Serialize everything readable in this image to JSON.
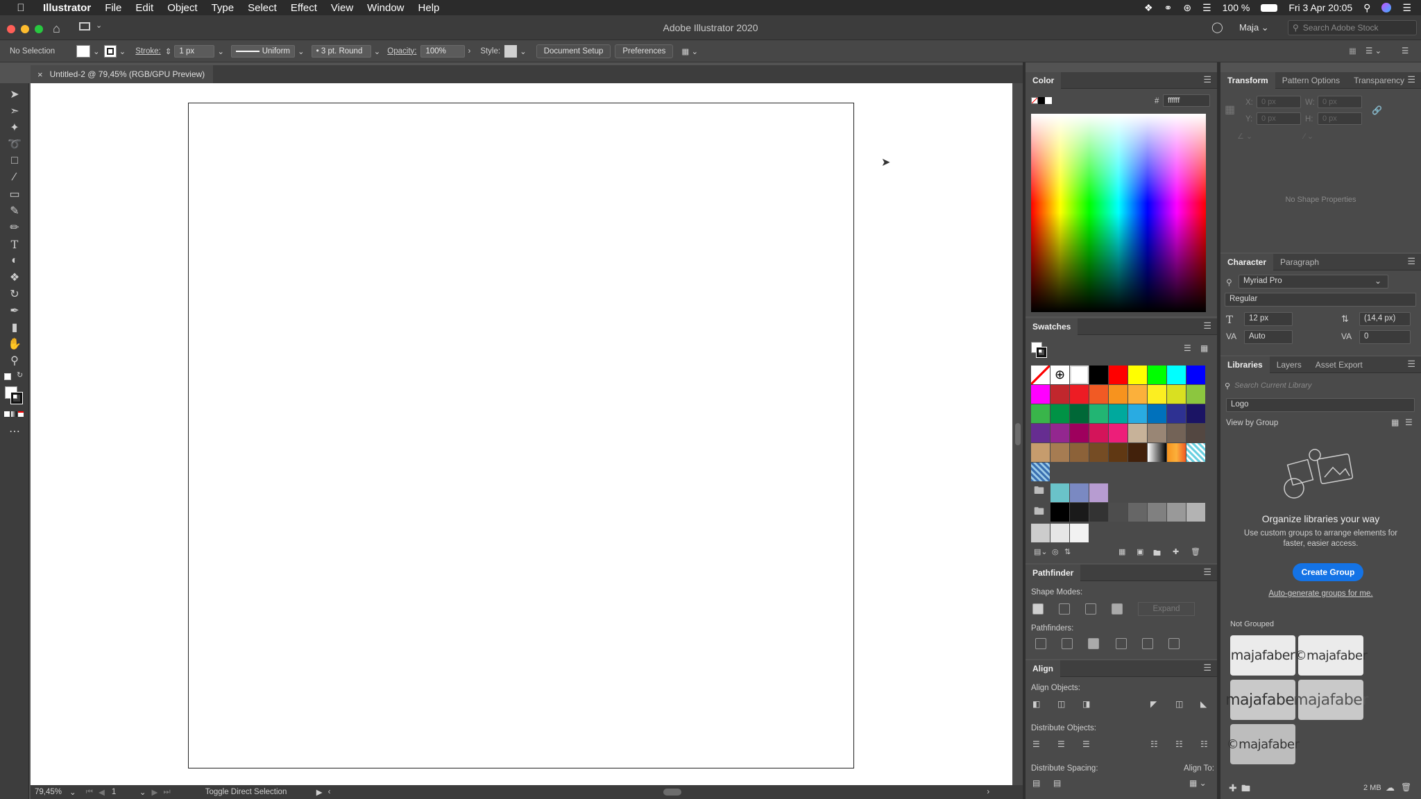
{
  "menubar": {
    "app": "Illustrator",
    "items": [
      "File",
      "Edit",
      "Object",
      "Type",
      "Select",
      "Effect",
      "View",
      "Window",
      "Help"
    ],
    "battery": "100 %",
    "clock": "Fri 3 Apr  20:05"
  },
  "titlebar": {
    "title": "Adobe Illustrator 2020",
    "user": "Maja",
    "search_placeholder": "Search Adobe Stock"
  },
  "controlbar": {
    "selection": "No Selection",
    "stroke_label": "Stroke:",
    "stroke_value": "1 px",
    "profile": "Uniform",
    "brush": "3 pt. Round",
    "opacity_label": "Opacity:",
    "opacity_value": "100%",
    "style_label": "Style:",
    "doc_setup": "Document Setup",
    "preferences": "Preferences"
  },
  "document": {
    "tab_title": "Untitled-2 @ 79,45% (RGB/GPU Preview)"
  },
  "statusbar": {
    "zoom": "79,45%",
    "artboard": "1",
    "hint": "Toggle Direct Selection"
  },
  "color_panel": {
    "title": "Color",
    "hex_label": "#",
    "hex": "ffffff"
  },
  "swatches_panel": {
    "title": "Swatches",
    "colors": [
      "#000000",
      "#ff0000",
      "#ffff00",
      "#00ff00",
      "#00ffff",
      "#0000ff",
      "#ff00ff",
      "#c1272d",
      "#ed1c24",
      "#f15a24",
      "#f7931e",
      "#fbb03b",
      "#fcee21",
      "#d9e021",
      "#8cc63f",
      "#39b54a",
      "#009245",
      "#006837",
      "#22b573",
      "#00a99d",
      "#29abe2",
      "#0071bc",
      "#2e3192",
      "#1b1464",
      "#662d91",
      "#93278f",
      "#9e005d",
      "#d4145a",
      "#ed1e79",
      "#c7b299",
      "#998675",
      "#736357",
      "#534741",
      "#c69c6d",
      "#a67c52",
      "#8c6239",
      "#754c24",
      "#603813",
      "#42210b"
    ],
    "group1": [
      "#6ac3c9",
      "#7a89c2",
      "#b79cd1"
    ],
    "group2": [
      "#000000",
      "#1a1a1a",
      "#333333",
      "#4d4d4d",
      "#666666",
      "#808080",
      "#999999",
      "#b3b3b3",
      "#cccccc",
      "#e6e6e6",
      "#f2f2f2"
    ]
  },
  "pathfinder_panel": {
    "title": "Pathfinder",
    "shape_modes": "Shape Modes:",
    "expand": "Expand",
    "pathfinders": "Pathfinders:"
  },
  "align_panel": {
    "title": "Align",
    "align_objects": "Align Objects:",
    "distribute_objects": "Distribute Objects:",
    "distribute_spacing": "Distribute Spacing:",
    "align_to": "Align To:"
  },
  "transform_panel": {
    "tabs": [
      "Transform",
      "Pattern Options",
      "Transparency"
    ],
    "x": "X:",
    "y": "Y:",
    "w": "W:",
    "h": "H:",
    "x_val": "0 px",
    "y_val": "0 px",
    "w_val": "0 px",
    "h_val": "0 px",
    "empty": "No Shape Properties"
  },
  "character_panel": {
    "tabs": [
      "Character",
      "Paragraph"
    ],
    "font": "Myriad Pro",
    "style": "Regular",
    "size": "12 px",
    "leading": "(14,4 px)",
    "kerning": "Auto",
    "tracking": "0"
  },
  "libraries_panel": {
    "tabs": [
      "Libraries",
      "Layers",
      "Asset Export"
    ],
    "search_placeholder": "Search Current Library",
    "library": "Logo",
    "view_by": "View by Group",
    "heading": "Organize libraries your way",
    "body": "Use custom groups to arrange elements for faster, easier access.",
    "create_button": "Create Group",
    "auto_link": "Auto-generate groups for me.",
    "not_grouped": "Not Grouped",
    "logos": [
      "majafaber",
      "majafaber",
      "majafaber",
      "majafaber",
      "majafaber"
    ],
    "storage": "2 MB"
  }
}
